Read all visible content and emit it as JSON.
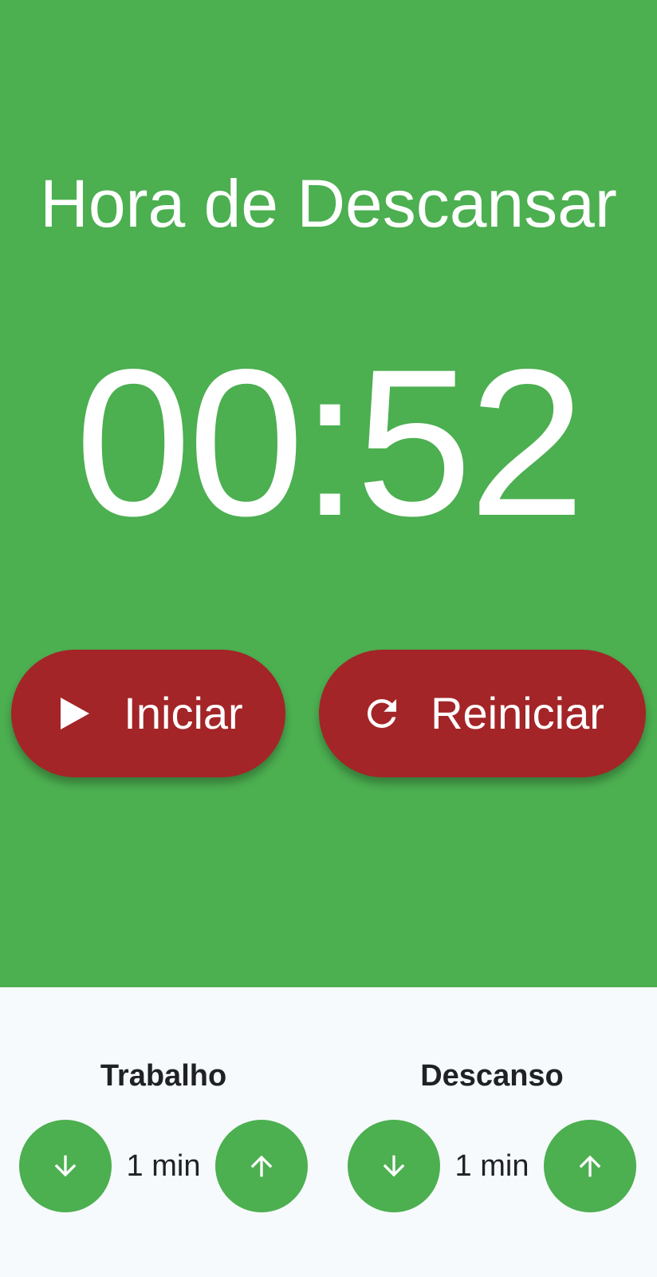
{
  "theme": {
    "timer_background": "#4caf50",
    "button_color": "#a32528",
    "settings_background": "#f6fafc"
  },
  "timer": {
    "mode_title": "Hora de Descansar",
    "time": "00:52"
  },
  "controls": {
    "start": {
      "label": "Iniciar",
      "icon": "play-icon"
    },
    "reset": {
      "label": "Reiniciar",
      "icon": "refresh-icon"
    }
  },
  "settings": {
    "work": {
      "title": "Trabalho",
      "value": "1 min",
      "decrease_icon": "arrow-down-icon",
      "increase_icon": "arrow-up-icon"
    },
    "rest": {
      "title": "Descanso",
      "value": "1 min",
      "decrease_icon": "arrow-down-icon",
      "increase_icon": "arrow-up-icon"
    }
  }
}
